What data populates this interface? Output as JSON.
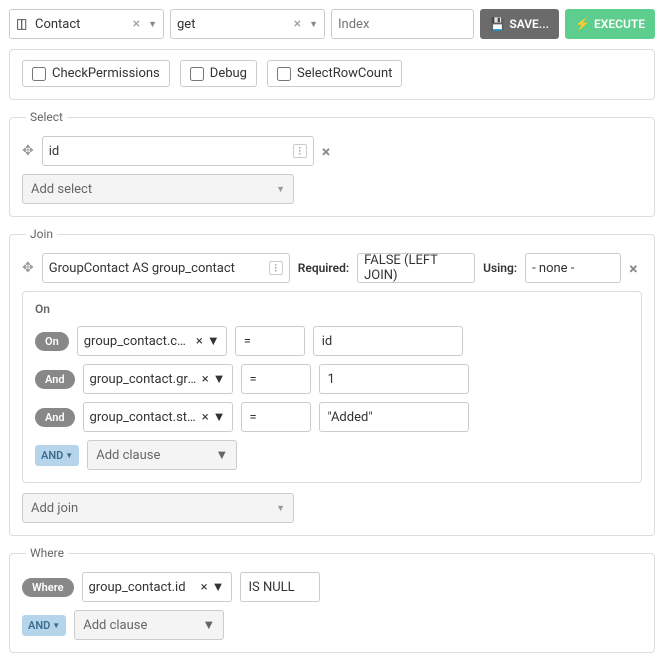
{
  "top": {
    "entity": "Contact",
    "action": "get",
    "index_placeholder": "Index",
    "save": "SAVE...",
    "execute": "EXECUTE"
  },
  "options": {
    "check_perms": "CheckPermissions",
    "debug": "Debug",
    "select_row_count": "SelectRowCount"
  },
  "select": {
    "legend": "Select",
    "field": "id",
    "add": "Add select"
  },
  "join": {
    "legend": "Join",
    "expr": "GroupContact AS group_contact",
    "required_label": "Required:",
    "required_value": "FALSE (LEFT JOIN)",
    "using_label": "Using:",
    "using_value": "- none -",
    "on": {
      "label": "On",
      "clauses": [
        {
          "tag": "On",
          "field": "group_contact.contac...",
          "op": "=",
          "val": "id"
        },
        {
          "tag": "And",
          "field": "group_contact.group_id",
          "op": "=",
          "val": "1"
        },
        {
          "tag": "And",
          "field": "group_contact.status",
          "op": "=",
          "val": "\"Added\""
        }
      ],
      "addpill": "AND",
      "addclause": "Add clause"
    },
    "add": "Add join"
  },
  "where": {
    "legend": "Where",
    "tag": "Where",
    "field": "group_contact.id",
    "op": "IS NULL",
    "addpill": "AND",
    "addclause": "Add clause"
  }
}
